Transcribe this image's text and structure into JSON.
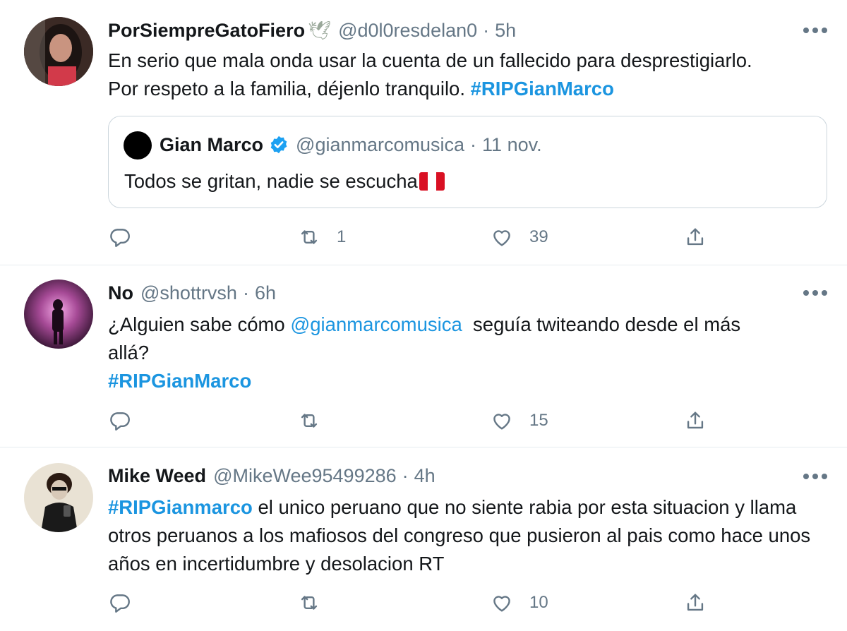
{
  "tweets": [
    {
      "name": "PorSiempreGatoFiero",
      "name_emoji": "🕊",
      "handle": "@d0l0resdelan0",
      "separator": "·",
      "time": "5h",
      "text_1": "En serio que mala onda usar la cuenta de un fallecido para desprestigiarlo.",
      "text_2": "Por respeto a la familia, déjenlo tranquilo.",
      "hashtag": "#RIPGianMarco",
      "quote": {
        "name": "Gian Marco",
        "handle": "@gianmarcomusica",
        "separator": "·",
        "time": "11 nov.",
        "text": "Todos se gritan, nadie se escucha"
      },
      "retweets": "1",
      "likes": "39"
    },
    {
      "name": "No",
      "handle": "@shottrvsh",
      "separator": "·",
      "time": "6h",
      "text_1": "¿Alguien sabe cómo",
      "mention": "@gianmarcomusica",
      "text_2": "seguía twiteando desde el más allá?",
      "hashtag": "#RIPGianMarco",
      "retweets": "",
      "likes": "15"
    },
    {
      "name": "Mike Weed",
      "handle": "@MikeWee95499286",
      "separator": "·",
      "time": "4h",
      "hashtag": "#RIPGianmarco",
      "text_1": "el unico peruano que no siente rabia por esta situacion y llama otros peruanos a los mafiosos del congreso que pusieron al pais como hace unos años en incertidumbre y desolacion RT",
      "retweets": "",
      "likes": "10"
    }
  ],
  "colors": {
    "link": "#1b95e0",
    "secondary_text": "#657786",
    "divider": "#e6ecf0",
    "verified": "#1da1f2"
  },
  "icons": [
    "reply-icon",
    "retweet-icon",
    "like-icon",
    "share-icon",
    "more-options-icon",
    "verified-badge-icon",
    "dove-emoji",
    "peru-flag-emoji"
  ]
}
